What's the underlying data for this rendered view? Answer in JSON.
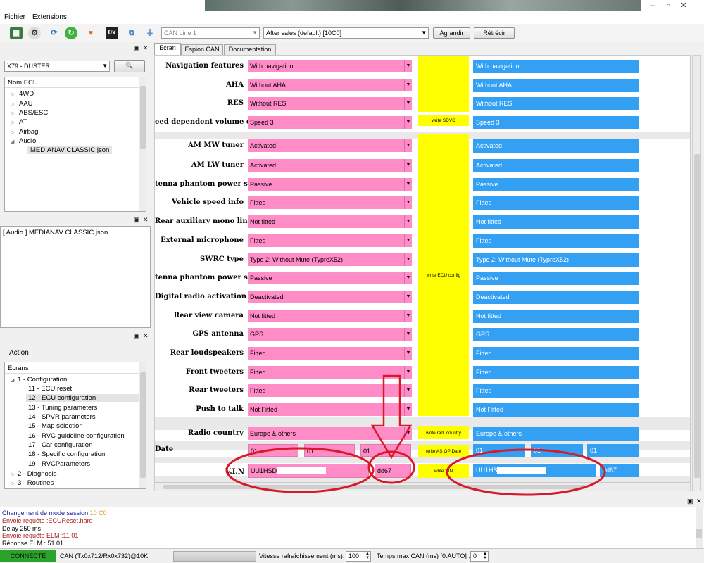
{
  "menu": {
    "file": "Fichier",
    "extensions": "Extensions"
  },
  "toolbar": {
    "icon_hex": "0x",
    "can_line": "CAN Line 1",
    "session": "After sales (default) [10C0]",
    "enlarge": "Agrandir",
    "shrink": "Rétrécir"
  },
  "vehicle": {
    "selected": "X79 - DUSTER"
  },
  "ecu_tree": {
    "header": "Nom ECU",
    "items": [
      "4WD",
      "AAU",
      "ABS/ESC",
      "AT",
      "Airbag",
      "Audio"
    ],
    "child": "MEDIANAV CLASSIC.json"
  },
  "loaded_file": "[ Audio ] MEDIANAV CLASSIC.json",
  "action": {
    "title": "Action",
    "header": "Ecrans",
    "config": "1 - Configuration",
    "screens": [
      "11 - ECU reset",
      "12 - ECU configuration",
      "13 - Tuning parameters",
      "14 - SPVR parameters",
      "15 - Map selection",
      "16 - RVC guideline configuration",
      "17 - Car configuration",
      "18 - Specific configuration",
      "19 - RVCParameters"
    ],
    "diagnosis": "2 - Diagnosis",
    "routines": "3 - Routines"
  },
  "tabs": [
    "Ecran",
    "Espion CAN",
    "Documentation"
  ],
  "form": {
    "rows": [
      {
        "label": "Navigation features",
        "value": "With navigation",
        "current": "With navigation"
      },
      {
        "label": "AHA",
        "value": "Without AHA",
        "current": "Without AHA"
      },
      {
        "label": "RES",
        "value": "Without RES",
        "current": "Without RES"
      },
      {
        "label": "eed dependent volume curve",
        "value": "Speed 3",
        "current": "Speed 3"
      },
      {
        "label": "AM MW tuner",
        "value": "Activated",
        "current": "Activated"
      },
      {
        "label": "AM LW tuner",
        "value": "Activated",
        "current": "Activated"
      },
      {
        "label": "tenna phantom power supply",
        "value": "Passive",
        "current": "Passive"
      },
      {
        "label": "Vehicle speed info",
        "value": "Fitted",
        "current": "Fitted"
      },
      {
        "label": "Rear auxiliary mono line in",
        "value": "Not fitted",
        "current": "Not fitted"
      },
      {
        "label": "External microphone",
        "value": "Fitted",
        "current": "Fitted"
      },
      {
        "label": "SWRC type",
        "value": "Type 2: Without Mute (TypreX52)",
        "current": "Type 2: Without Mute (TypreX52)"
      },
      {
        "label": "tenna phantom power supply",
        "value": "Passive",
        "current": "Passive"
      },
      {
        "label": "Digital radio activation",
        "value": "Deactivated",
        "current": "Deactivated"
      },
      {
        "label": "Rear view camera",
        "value": "Not fitted",
        "current": "Not fitted"
      },
      {
        "label": "GPS antenna",
        "value": "GPS",
        "current": "GPS"
      },
      {
        "label": "Rear loudspeakers",
        "value": "Fitted",
        "current": "Fitted"
      },
      {
        "label": "Front tweeters",
        "value": "Fitted",
        "current": "Fitted"
      },
      {
        "label": "Rear tweeters",
        "value": "Fitted",
        "current": "Fitted"
      },
      {
        "label": "Push to talk",
        "value": "Not Fitted",
        "current": "Not Fitted"
      },
      {
        "label": "Radio country",
        "value": "Europe & others",
        "current": "Europe & others"
      }
    ],
    "date_label": "Date",
    "date_values": [
      "01",
      "01",
      "01"
    ],
    "date_current": [
      "01",
      "01",
      "01"
    ],
    "vin_label": "V.I.N",
    "vin_value": "UU1HSD",
    "vin_suffix": "dd67",
    "vin_current": "UU1HSD",
    "vin_current_suffix": "dd67",
    "write_sdvc": "write SDVC",
    "write_ecu": "write ECU config",
    "write_country": "write rad. country",
    "write_date": "write AS OP Date",
    "write_vin": "write VIN"
  },
  "log": [
    {
      "text": "Changement de mode session ",
      "extra": "10 C0",
      "color": "#1a1aa0"
    },
    {
      "text": "Envoie requête :ECUReset.hard",
      "color": "#b01e1e"
    },
    {
      "text": "Delay 250 ms",
      "color": "#000000"
    },
    {
      "text": "Envoie requête ELM :11 01",
      "color": "#b01e1e"
    },
    {
      "text": "Réponse ELM : 51 01",
      "color": "#000000"
    }
  ],
  "status": {
    "connected": "CONNECTÉ",
    "can_info": "CAN (Tx0x712/Rx0x732)@10K",
    "refresh_label": "Vitesse rafraîchissement (ms):",
    "refresh_value": "100",
    "can_time_label": "Temps max CAN (ms) [0:AUTO] :",
    "can_time_value": "0"
  },
  "colors": {
    "pink": "#ff8cc6",
    "blue": "#33a0f4",
    "yellow": "#ffff00",
    "connected": "#29a329",
    "annotation": "#d7192a"
  }
}
